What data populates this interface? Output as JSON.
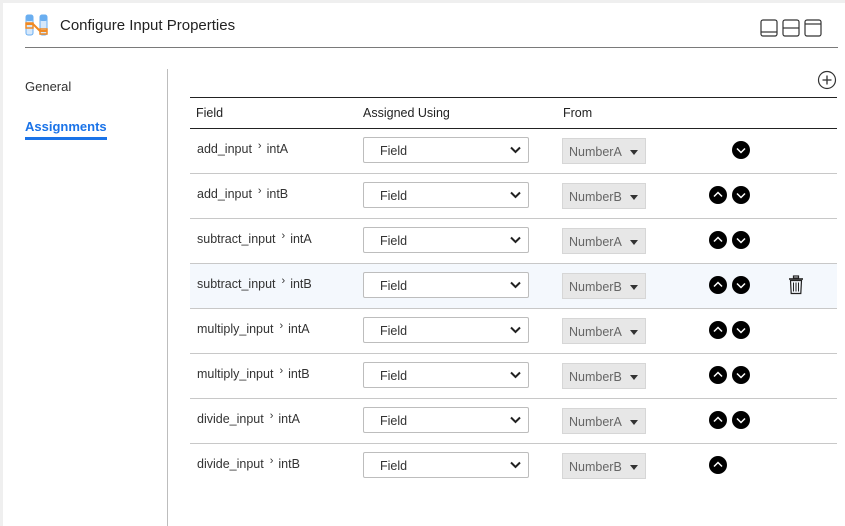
{
  "header": {
    "title": "Configure Input Properties",
    "app_icon": "mapping-icon",
    "layout_icons": [
      "layout-bottom-panel-icon",
      "layout-split-icon",
      "layout-top-panel-icon"
    ]
  },
  "sidebar": {
    "items": [
      {
        "label": "General",
        "active": false
      },
      {
        "label": "Assignments",
        "active": true
      }
    ],
    "accent_color": "#1a73e8"
  },
  "toolbar": {
    "add_icon": "add-circle-icon"
  },
  "table": {
    "columns": [
      "Field",
      "Assigned Using",
      "From"
    ],
    "rows": [
      {
        "parent": "add_input",
        "field": "intA",
        "assigned_using": "Field",
        "from": "NumberA",
        "move_up": false,
        "move_down": true,
        "highlighted": false,
        "delete": false
      },
      {
        "parent": "add_input",
        "field": "intB",
        "assigned_using": "Field",
        "from": "NumberB",
        "move_up": true,
        "move_down": true,
        "highlighted": false,
        "delete": false
      },
      {
        "parent": "subtract_input",
        "field": "intA",
        "assigned_using": "Field",
        "from": "NumberA",
        "move_up": true,
        "move_down": true,
        "highlighted": false,
        "delete": false
      },
      {
        "parent": "subtract_input",
        "field": "intB",
        "assigned_using": "Field",
        "from": "NumberB",
        "move_up": true,
        "move_down": true,
        "highlighted": true,
        "delete": true
      },
      {
        "parent": "multiply_input",
        "field": "intA",
        "assigned_using": "Field",
        "from": "NumberA",
        "move_up": true,
        "move_down": true,
        "highlighted": false,
        "delete": false
      },
      {
        "parent": "multiply_input",
        "field": "intB",
        "assigned_using": "Field",
        "from": "NumberB",
        "move_up": true,
        "move_down": true,
        "highlighted": false,
        "delete": false
      },
      {
        "parent": "divide_input",
        "field": "intA",
        "assigned_using": "Field",
        "from": "NumberA",
        "move_up": true,
        "move_down": true,
        "highlighted": false,
        "delete": false
      },
      {
        "parent": "divide_input",
        "field": "intB",
        "assigned_using": "Field",
        "from": "NumberB",
        "move_up": true,
        "move_down": false,
        "highlighted": false,
        "delete": false
      }
    ],
    "separator_glyph": "›"
  }
}
